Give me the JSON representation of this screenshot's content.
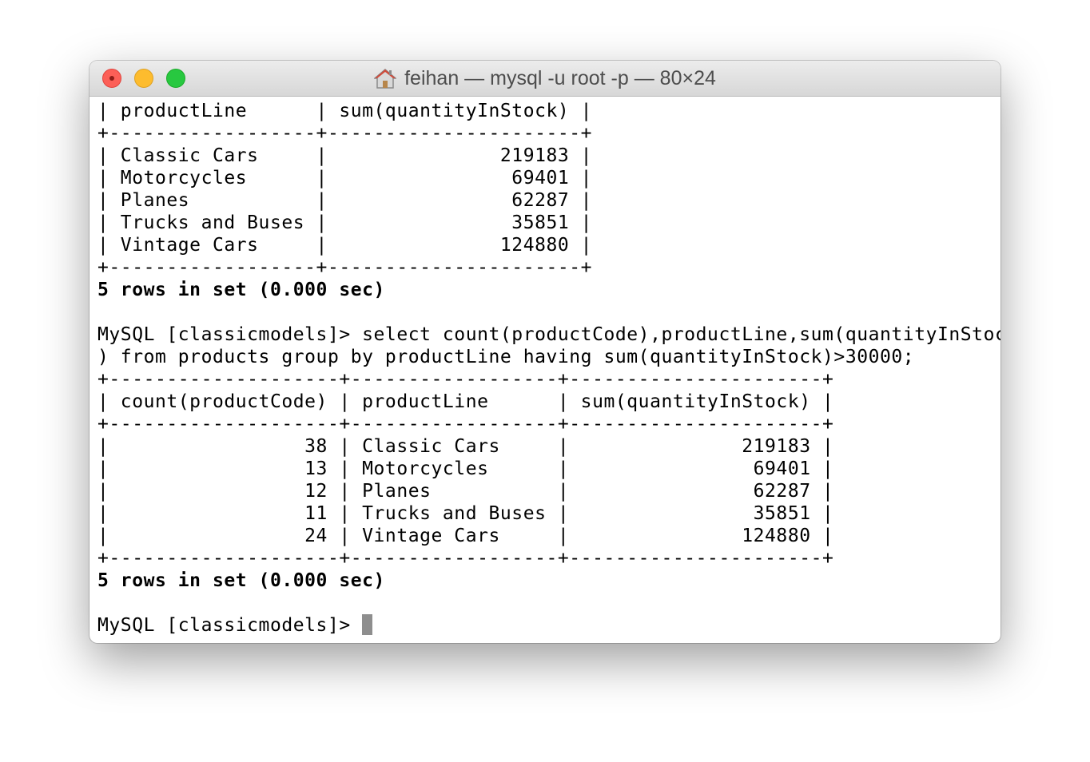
{
  "window": {
    "title": "feihan — mysql -u root -p — 80×24"
  },
  "terminal": {
    "lines": [
      {
        "text": "| productLine      | sum(quantityInStock) |",
        "bold": false
      },
      {
        "text": "+------------------+----------------------+",
        "bold": false
      },
      {
        "text": "| Classic Cars     |               219183 |",
        "bold": false
      },
      {
        "text": "| Motorcycles      |                69401 |",
        "bold": false
      },
      {
        "text": "| Planes           |                62287 |",
        "bold": false
      },
      {
        "text": "| Trucks and Buses |                35851 |",
        "bold": false
      },
      {
        "text": "| Vintage Cars     |               124880 |",
        "bold": false
      },
      {
        "text": "+------------------+----------------------+",
        "bold": false
      },
      {
        "text": "5 rows in set (0.000 sec)",
        "bold": true
      },
      {
        "text": "",
        "bold": false
      },
      {
        "text": "MySQL [classicmodels]> select count(productCode),productLine,sum(quantityInStock",
        "bold": false
      },
      {
        "text": ") from products group by productLine having sum(quantityInStock)>30000;",
        "bold": false
      },
      {
        "text": "+--------------------+------------------+----------------------+",
        "bold": false
      },
      {
        "text": "| count(productCode) | productLine      | sum(quantityInStock) |",
        "bold": false
      },
      {
        "text": "+--------------------+------------------+----------------------+",
        "bold": false
      },
      {
        "text": "|                 38 | Classic Cars     |               219183 |",
        "bold": false
      },
      {
        "text": "|                 13 | Motorcycles      |                69401 |",
        "bold": false
      },
      {
        "text": "|                 12 | Planes           |                62287 |",
        "bold": false
      },
      {
        "text": "|                 11 | Trucks and Buses |                35851 |",
        "bold": false
      },
      {
        "text": "|                 24 | Vintage Cars     |               124880 |",
        "bold": false
      },
      {
        "text": "+--------------------+------------------+----------------------+",
        "bold": false
      },
      {
        "text": "5 rows in set (0.000 sec)",
        "bold": true
      },
      {
        "text": "",
        "bold": false
      }
    ],
    "prompt": "MySQL [classicmodels]> "
  }
}
